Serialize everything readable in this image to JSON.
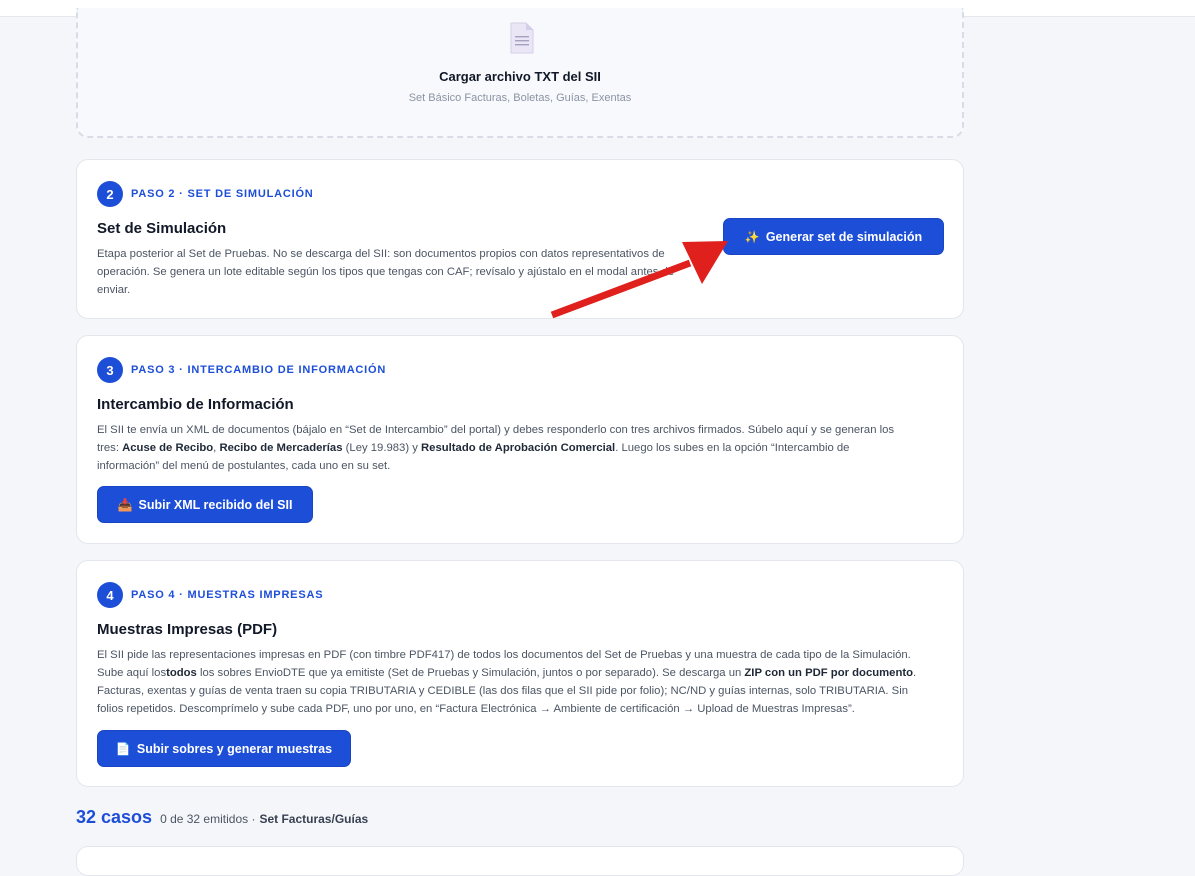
{
  "upload": {
    "title": "Cargar archivo TXT del SII",
    "subtitle": "Set Básico Facturas, Boletas, Guías, Exentas",
    "icon": "document-icon"
  },
  "step2": {
    "number": "2",
    "label": "PASO 2 · SET DE SIMULACIÓN",
    "title": "Set de Simulación",
    "desc": [
      "Etapa posterior al Set de Pruebas. No se descarga del SII: son documentos propios con datos representativos de",
      "operación. Se genera un lote editable según los tipos que tengas con CAF; revísalo y ajústalo en el modal antes de",
      "enviar."
    ],
    "button_icon": "✨",
    "button_label": "Generar set de simulación"
  },
  "step3": {
    "number": "3",
    "label": "PASO 3 · INTERCAMBIO DE INFORMACIÓN",
    "title": "Intercambio de Información",
    "desc1": "El SII te envía un XML de documentos (bájalo en “Set de Intercambio” del portal) y debes responderlo con tres archivos firmados. Súbelo aquí y se generan los",
    "desc2_prefix": "tres: ",
    "desc2_b1": "Acuse de Recibo",
    "desc2_sep1": ", ",
    "desc2_b2": "Recibo de Mercaderías",
    "desc2_mid": " (Ley 19.983) y ",
    "desc2_b3": "Resultado de Aprobación Comercial",
    "desc2_suffix": ". Luego los subes en la opción “Intercambio de",
    "desc3": "información” del menú de postulantes, cada uno en su set.",
    "button_icon": "📥",
    "button_label": "Subir XML recibido del SII"
  },
  "step4": {
    "number": "4",
    "label": "PASO 4 · MUESTRAS IMPRESAS",
    "title": "Muestras Impresas (PDF)",
    "desc1": "El SII pide las representaciones impresas en PDF (con timbre PDF417) de todos los documentos del Set de Pruebas y una muestra de cada tipo de la Simulación.",
    "desc2_prefix": "Sube aquí los",
    "desc2_b1": "todos",
    "desc2_mid": " los sobres EnvioDTE que ya emitiste (Set de Pruebas y Simulación, juntos o por separado). Se descarga un ",
    "desc2_b2": "ZIP con un PDF por documento",
    "desc2_suffix": ".",
    "desc3": "Facturas, exentas y guías de venta traen su copia TRIBUTARIA y CEDIBLE (las dos filas que el SII pide por folio); NC/ND y guías internas, solo TRIBUTARIA. Sin",
    "desc4": "folios repetidos. Descomprímelo y sube cada PDF, uno por uno, en “Factura Electrónica → Ambiente de certificación → Upload de Muestras Impresas”.",
    "button_icon": "📄",
    "button_label": "Subir sobres y generar muestras"
  },
  "summary": {
    "count": "32 casos",
    "emitted": "0 de 32 emitidos ·",
    "set_name": "Set Facturas/Guías"
  },
  "colors": {
    "primary": "#1d4ed8",
    "arrow": "#e0201c"
  }
}
